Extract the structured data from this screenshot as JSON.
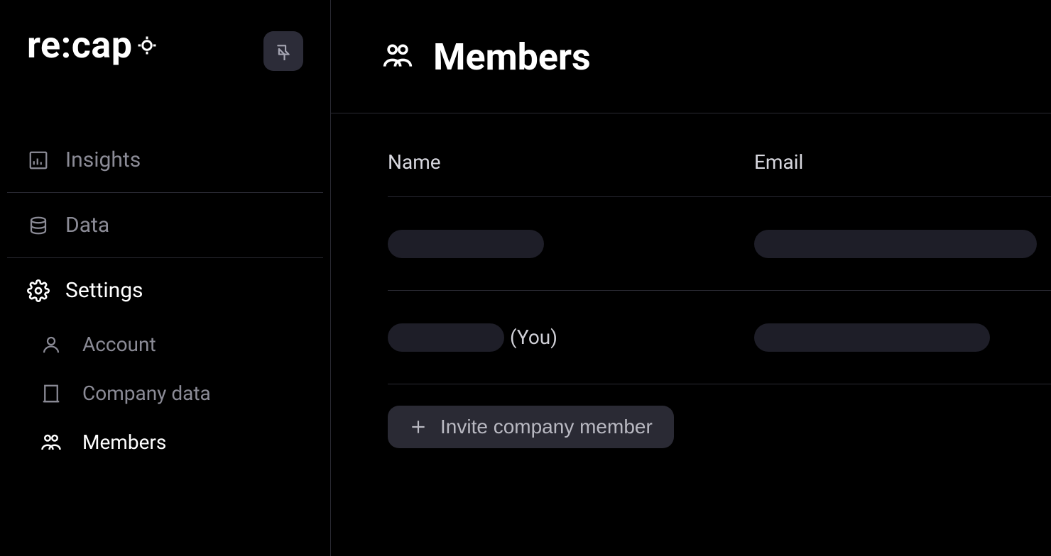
{
  "brand": {
    "name": "re:cap"
  },
  "sidebar": {
    "items": [
      {
        "label": "Insights"
      },
      {
        "label": "Data"
      },
      {
        "label": "Settings"
      }
    ],
    "subitems": [
      {
        "label": "Account"
      },
      {
        "label": "Company data"
      },
      {
        "label": "Members"
      }
    ]
  },
  "page": {
    "title": "Members",
    "columns": {
      "name": "Name",
      "email": "Email"
    },
    "rows": [
      {
        "you_suffix": ""
      },
      {
        "you_suffix": "(You)"
      }
    ],
    "invite_label": "Invite company member"
  }
}
